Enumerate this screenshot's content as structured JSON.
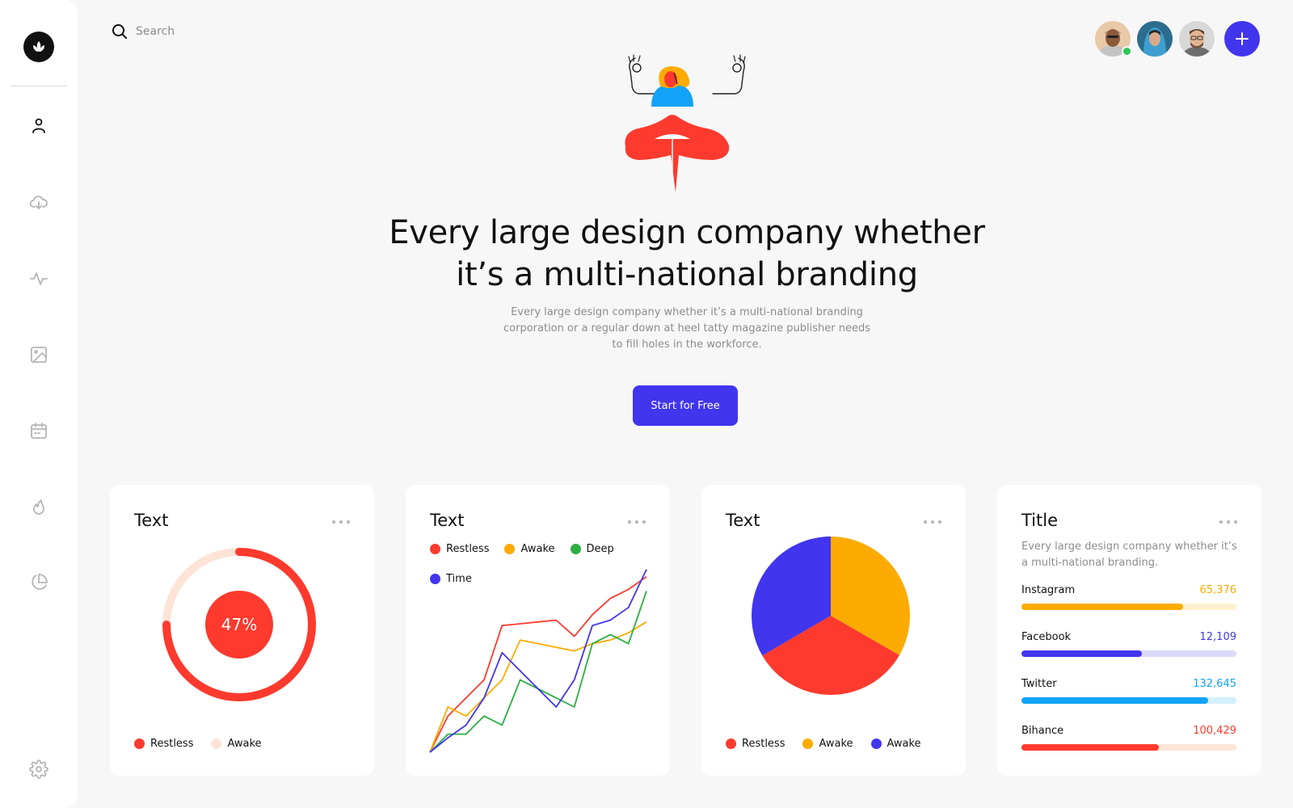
{
  "search": {
    "placeholder": "Search"
  },
  "hero": {
    "title_line1": "Every large design company whether",
    "title_line2": "it’s a multi-national branding",
    "subtitle": "Every large design company whether it’s a multi-national branding corporation or a regular down at heel tatty magazine publisher needs to fill holes in the workforce.",
    "cta_label": "Start for Free"
  },
  "sidebar": {
    "items": [
      "user-icon",
      "cloud-download-icon",
      "activity-icon",
      "image-icon",
      "calendar-icon",
      "flame-icon",
      "pie-chart-icon",
      "settings-icon"
    ]
  },
  "colors": {
    "accent": "#4135ee",
    "red": "#fd3a2d",
    "orange": "#fdab00",
    "green": "#2dae42",
    "blue": "#4135ee",
    "light_blue": "#12a3f8"
  },
  "cards": {
    "donut": {
      "title": "Text",
      "center_label": "47%",
      "legend": [
        {
          "label": "Restless",
          "color": "#fd3a2d"
        },
        {
          "label": "Awake",
          "color": "#fde4d6"
        }
      ]
    },
    "line": {
      "title": "Text",
      "legend": [
        {
          "label": "Restless",
          "color": "#fd3a2d"
        },
        {
          "label": "Awake",
          "color": "#fdab00"
        },
        {
          "label": "Deep",
          "color": "#2dae42"
        },
        {
          "label": "Time",
          "color": "#4135ee"
        }
      ]
    },
    "pie": {
      "title": "Text",
      "legend": [
        {
          "label": "Restless",
          "color": "#fd3a2d"
        },
        {
          "label": "Awake",
          "color": "#fdab00"
        },
        {
          "label": "Awake",
          "color": "#4135ee"
        }
      ]
    },
    "stats": {
      "title": "Title",
      "description": "Every large design company whether it’s a multi-national branding.",
      "rows": [
        {
          "name": "Instagram",
          "value": "65,376",
          "progress": 0.75,
          "color": "#fdab00",
          "track": "#fdf1cf"
        },
        {
          "name": "Facebook",
          "value": "12,109",
          "progress": 0.56,
          "color": "#4135ee",
          "track": "#dad9f7"
        },
        {
          "name": "Twitter",
          "value": "132,645",
          "progress": 0.87,
          "color": "#12a3f8",
          "track": "#d3f0fd"
        },
        {
          "name": "Bihance",
          "value": "100,429",
          "progress": 0.64,
          "color": "#fd3a2d",
          "track": "#fde4d6"
        }
      ]
    }
  },
  "chart_data": [
    {
      "type": "pie",
      "subtype": "donut",
      "title": "Text",
      "center_label": "47%",
      "segments": [
        {
          "name": "Restless",
          "value": 75
        },
        {
          "name": "Awake",
          "value": 25
        }
      ]
    },
    {
      "type": "line",
      "title": "Text",
      "x": [
        1,
        2,
        3,
        4,
        5,
        6,
        7,
        8,
        9,
        10,
        11,
        12,
        13
      ],
      "ylim": [
        0,
        100
      ],
      "series": [
        {
          "name": "Restless",
          "values": [
            0,
            20,
            30,
            40,
            70,
            71,
            72,
            73,
            64,
            76,
            85,
            90,
            97
          ]
        },
        {
          "name": "Awake",
          "values": [
            0,
            25,
            20,
            30,
            40,
            62,
            60,
            58,
            56,
            60,
            62,
            66,
            72
          ]
        },
        {
          "name": "Deep",
          "values": [
            0,
            10,
            10,
            20,
            15,
            40,
            35,
            30,
            25,
            60,
            65,
            60,
            89
          ]
        },
        {
          "name": "Time",
          "values": [
            0,
            8,
            15,
            30,
            55,
            45,
            35,
            25,
            40,
            70,
            73,
            80,
            101
          ]
        }
      ]
    },
    {
      "type": "pie",
      "title": "Text",
      "slices": [
        {
          "name": "Awake",
          "value": 33.3,
          "color": "#fdab00"
        },
        {
          "name": "Restless",
          "value": 33.3,
          "color": "#fd3a2d"
        },
        {
          "name": "Awake",
          "value": 33.4,
          "color": "#4135ee"
        }
      ]
    }
  ]
}
